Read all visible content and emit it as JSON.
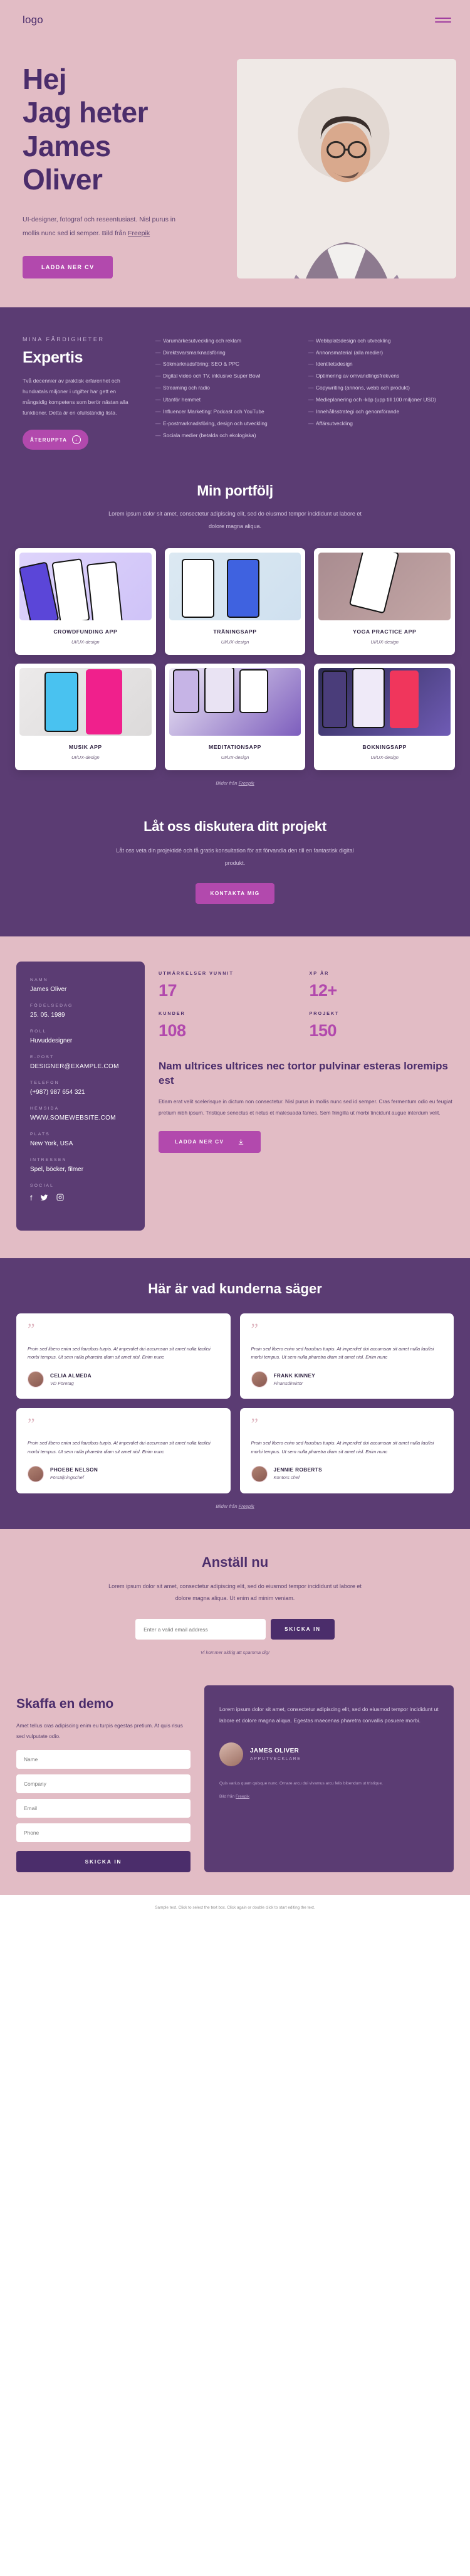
{
  "header": {
    "logo": "logo",
    "menu_icon": "hamburger-menu"
  },
  "hero": {
    "title_lines": [
      "Hej",
      "Jag heter",
      "James",
      "Oliver"
    ],
    "description": "UI-designer, fotograf och reseentusiast. Nisl purus in mollis nunc sed id semper. Bild från ",
    "description_link": "Freepik",
    "cta": "LADDA NER CV"
  },
  "skills": {
    "eyebrow": "MINA FÄRDIGHETER",
    "heading": "Expertis",
    "paragraph": "Två decennier av praktisk erfarenhet och hundratals miljoner i utgifter har gett en mångsidig kompetens som berör nästan alla funktioner. Detta är en ofullständig lista.",
    "pill": "ÅTERUPPTA",
    "pill_icon": "download-circle-icon",
    "column1": [
      "Varumärkesutveckling och reklam",
      "Direktsvarsmarknadsföring",
      "Sökmarknadsföring: SEO & PPC",
      "Digital video och TV, inklusive Super Bowl",
      "Streaming och radio",
      "Utanför hemmet",
      "Influencer Marketing: Podcast och YouTube",
      "E-postmarknadsföring, design och utveckling",
      "Sociala medier (betalda och ekologiska)"
    ],
    "column2": [
      "Webbplatsdesign och utveckling",
      "Annonsmaterial (alla medier)",
      "Identitetsdesign",
      "Optimering av omvandlingsfrekvens",
      "Copywriting (annons, webb och produkt)",
      "Medieplanering och -köp (upp till 100 miljoner USD)",
      "Innehållsstrategi och genomförande",
      "Affärsutveckling"
    ]
  },
  "portfolio": {
    "title": "Min portfölj",
    "subtitle": "Lorem ipsum dolor sit amet, consectetur adipiscing elit, sed do eiusmod tempor incididunt ut labore et dolore magna aliqua.",
    "items": [
      {
        "name": "CROWDFUNDING APP",
        "category": "UI/UX-design"
      },
      {
        "name": "TRÄNINGSAPP",
        "category": "UI/UX-design"
      },
      {
        "name": "YOGA PRACTICE APP",
        "category": "UI/UX-design"
      },
      {
        "name": "MUSIK APP",
        "category": "UI/UX-design"
      },
      {
        "name": "MEDITATIONSAPP",
        "category": "UI/UX-design"
      },
      {
        "name": "BOKNINGSAPP",
        "category": "UI/UX-design"
      }
    ],
    "credit_prefix": "Bilder från ",
    "credit_link": "Freepik"
  },
  "cta": {
    "title": "Låt oss diskutera ditt projekt",
    "text": "Låt oss veta din projektidé och få gratis konsultation för att förvandla den till en fantastisk digital produkt.",
    "button": "KONTAKTA MIG"
  },
  "about": {
    "info": [
      {
        "label": "NAMN",
        "value": "James Oliver"
      },
      {
        "label": "FÖDELSEDAG",
        "value": "25. 05. 1989"
      },
      {
        "label": "ROLL",
        "value": "Huvuddesigner"
      },
      {
        "label": "E-POST",
        "value": "DESIGNER@EXAMPLE.COM"
      },
      {
        "label": "TELEFON",
        "value": "(+987) 987 654 321"
      },
      {
        "label": "HEMSIDA",
        "value": "WWW.SOMEWEBSITE.COM"
      },
      {
        "label": "PLATS",
        "value": "New York, USA"
      },
      {
        "label": "INTRESSEN",
        "value": "Spel, böcker, filmer"
      }
    ],
    "social_label": "SOCIAL",
    "socials": [
      "facebook-icon",
      "twitter-icon",
      "instagram-icon"
    ],
    "stats": [
      {
        "label": "UTMÄRKELSER VUNNIT",
        "value": "17"
      },
      {
        "label": "XP ÅR",
        "value": "12+"
      },
      {
        "label": "KUNDER",
        "value": "108"
      },
      {
        "label": "PROJEKT",
        "value": "150"
      }
    ],
    "heading": "Nam ultrices ultrices nec tortor pulvinar esteras loremips est",
    "paragraph": "Etiam erat velit scelerisque in dictum non consectetur. Nisl purus in mollis nunc sed id semper. Cras fermentum odio eu feugiat pretium nibh ipsum. Tristique senectus et netus et malesuada fames. Sem fringilla ut morbi tincidunt augue interdum velit.",
    "button": "LADDA NER CV",
    "button_icon": "download-icon"
  },
  "testimonials": {
    "title": "Här är vad kunderna säger",
    "items": [
      {
        "text": "Proin sed libero enim sed faucibus turpis. At imperdiet dui accumsan sit amet nulla facilisi morbi tempus. Ut sem nulla pharetra diam sit amet nisl. Enim nunc",
        "name": "CELIA ALMEDA",
        "role": "VD Företag"
      },
      {
        "text": "Proin sed libero enim sed faucibus turpis. At imperdiet dui accumsan sit amet nulla facilisi morbi tempus. Ut sem nulla pharetra diam sit amet nisl. Enim nunc",
        "name": "FRANK KINNEY",
        "role": "Finansdirektör"
      },
      {
        "text": "Proin sed libero enim sed faucibus turpis. At imperdiet dui accumsan sit amet nulla facilisi morbi tempus. Ut sem nulla pharetra diam sit amet nisl. Enim nunc",
        "name": "PHOEBE NELSON",
        "role": "Försäljningschef"
      },
      {
        "text": "Proin sed libero enim sed faucibus turpis. At imperdiet dui accumsan sit amet nulla facilisi morbi tempus. Ut sem nulla pharetra diam sit amet nisl. Enim nunc",
        "name": "JENNIE ROBERTS",
        "role": "Kontors chef"
      }
    ],
    "credit_prefix": "Bilder från ",
    "credit_link": "Freepik"
  },
  "signup": {
    "title": "Anställ nu",
    "text": "Lorem ipsum dolor sit amet, consectetur adipiscing elit, sed do eiusmod tempor incididunt ut labore et dolore magna aliqua. Ut enim ad minim veniam.",
    "placeholder": "Enter a valid email address",
    "button": "SKICKA IN",
    "note": "Vi kommer aldrig att spamma dig!"
  },
  "demo": {
    "title": "Skaffa en demo",
    "text": "Amet tellus cras adipiscing enim eu turpis egestas pretium. At quis risus sed vulputate odio.",
    "fields": [
      "Name",
      "Company",
      "Email",
      "Phone"
    ],
    "button": "SKICKA IN",
    "right_text": "Lorem ipsum dolor sit amet, consectetur adipiscing elit, sed do eiusmod tempor incididunt ut labore et dolore magna aliqua. Egestas maecenas pharetra convallis posuere morbi.",
    "person_name": "JAMES OLIVER",
    "person_role": "APPUTVECKLARE",
    "note": "Quis varius quam quisque nunc. Ornare arcu dui vivamus arcu felis bibendum ut tristique.",
    "credit_prefix": "Bild från ",
    "credit_link": "Freepik"
  },
  "footer": {
    "line1": "Sample text. Click to select the text box. Click again or double click to start editing the text.",
    "line2": ""
  }
}
